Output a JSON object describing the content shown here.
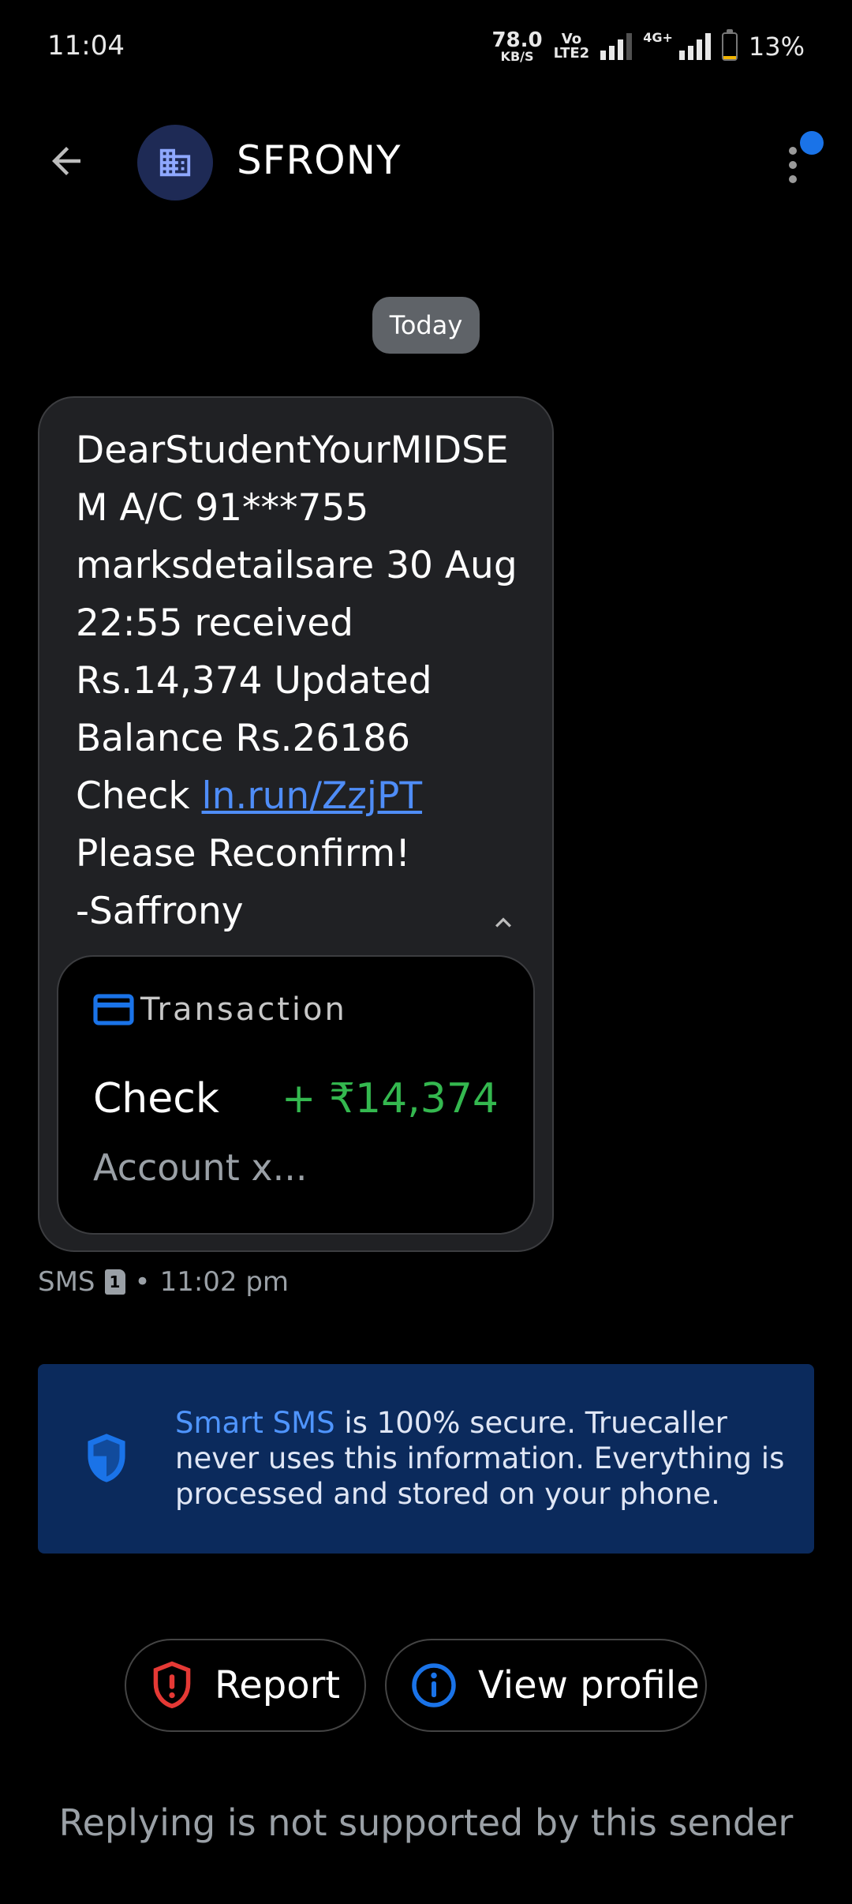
{
  "status_bar": {
    "time": "11:04",
    "net_speed_value": "78.0",
    "net_speed_unit": "KB/S",
    "volte_top": "Vo",
    "volte_bottom": "LTE2",
    "network_type": "4G+",
    "battery_level": 0.13,
    "battery_percent": "13%",
    "battery_color": "#f2b600"
  },
  "header": {
    "sender_name": "SFRONY",
    "back_icon": "arrow-left-icon",
    "avatar_icon": "building-icon",
    "menu_icon": "more-vert-icon",
    "notification_color": "#1a73e8"
  },
  "date_chip": "Today",
  "message": {
    "lines": [
      "DearStudentYourMIDSE",
      "M A/C 91***755",
      "marksdetailsare 30 Aug",
      "22:55 received",
      "Rs.14,374 Updated",
      "Balance Rs.26186"
    ],
    "check_prefix": "Check ",
    "link": "ln.run/ZzjPT",
    "line_after_link": "Please Reconfirm!",
    "signature": "-Saffrony",
    "collapse_icon": "chevron-up-icon",
    "link_color": "#4f8df7"
  },
  "transaction": {
    "icon": "credit-card-icon",
    "title": "Transaction",
    "label": "Check",
    "amount": "+ ₹14,374",
    "account": "Account x...",
    "amount_color": "#34b84f"
  },
  "meta": {
    "type": "SMS",
    "sim": "1",
    "separator": "•",
    "time": "11:02 pm"
  },
  "smart_sms": {
    "icon": "shield-icon",
    "brand": "Smart SMS",
    "text": " is 100% secure. Truecaller never uses this information. Everything is processed and stored on your phone.",
    "background": "#0b2a5c",
    "brand_color": "#4f95ff"
  },
  "actions": {
    "report_label": "Report",
    "report_icon": "shield-alert-icon",
    "report_color": "#e53935",
    "view_profile_label": "View profile",
    "view_profile_icon": "info-icon",
    "view_profile_color": "#1a73e8"
  },
  "reply_note": "Replying is not supported by this sender"
}
